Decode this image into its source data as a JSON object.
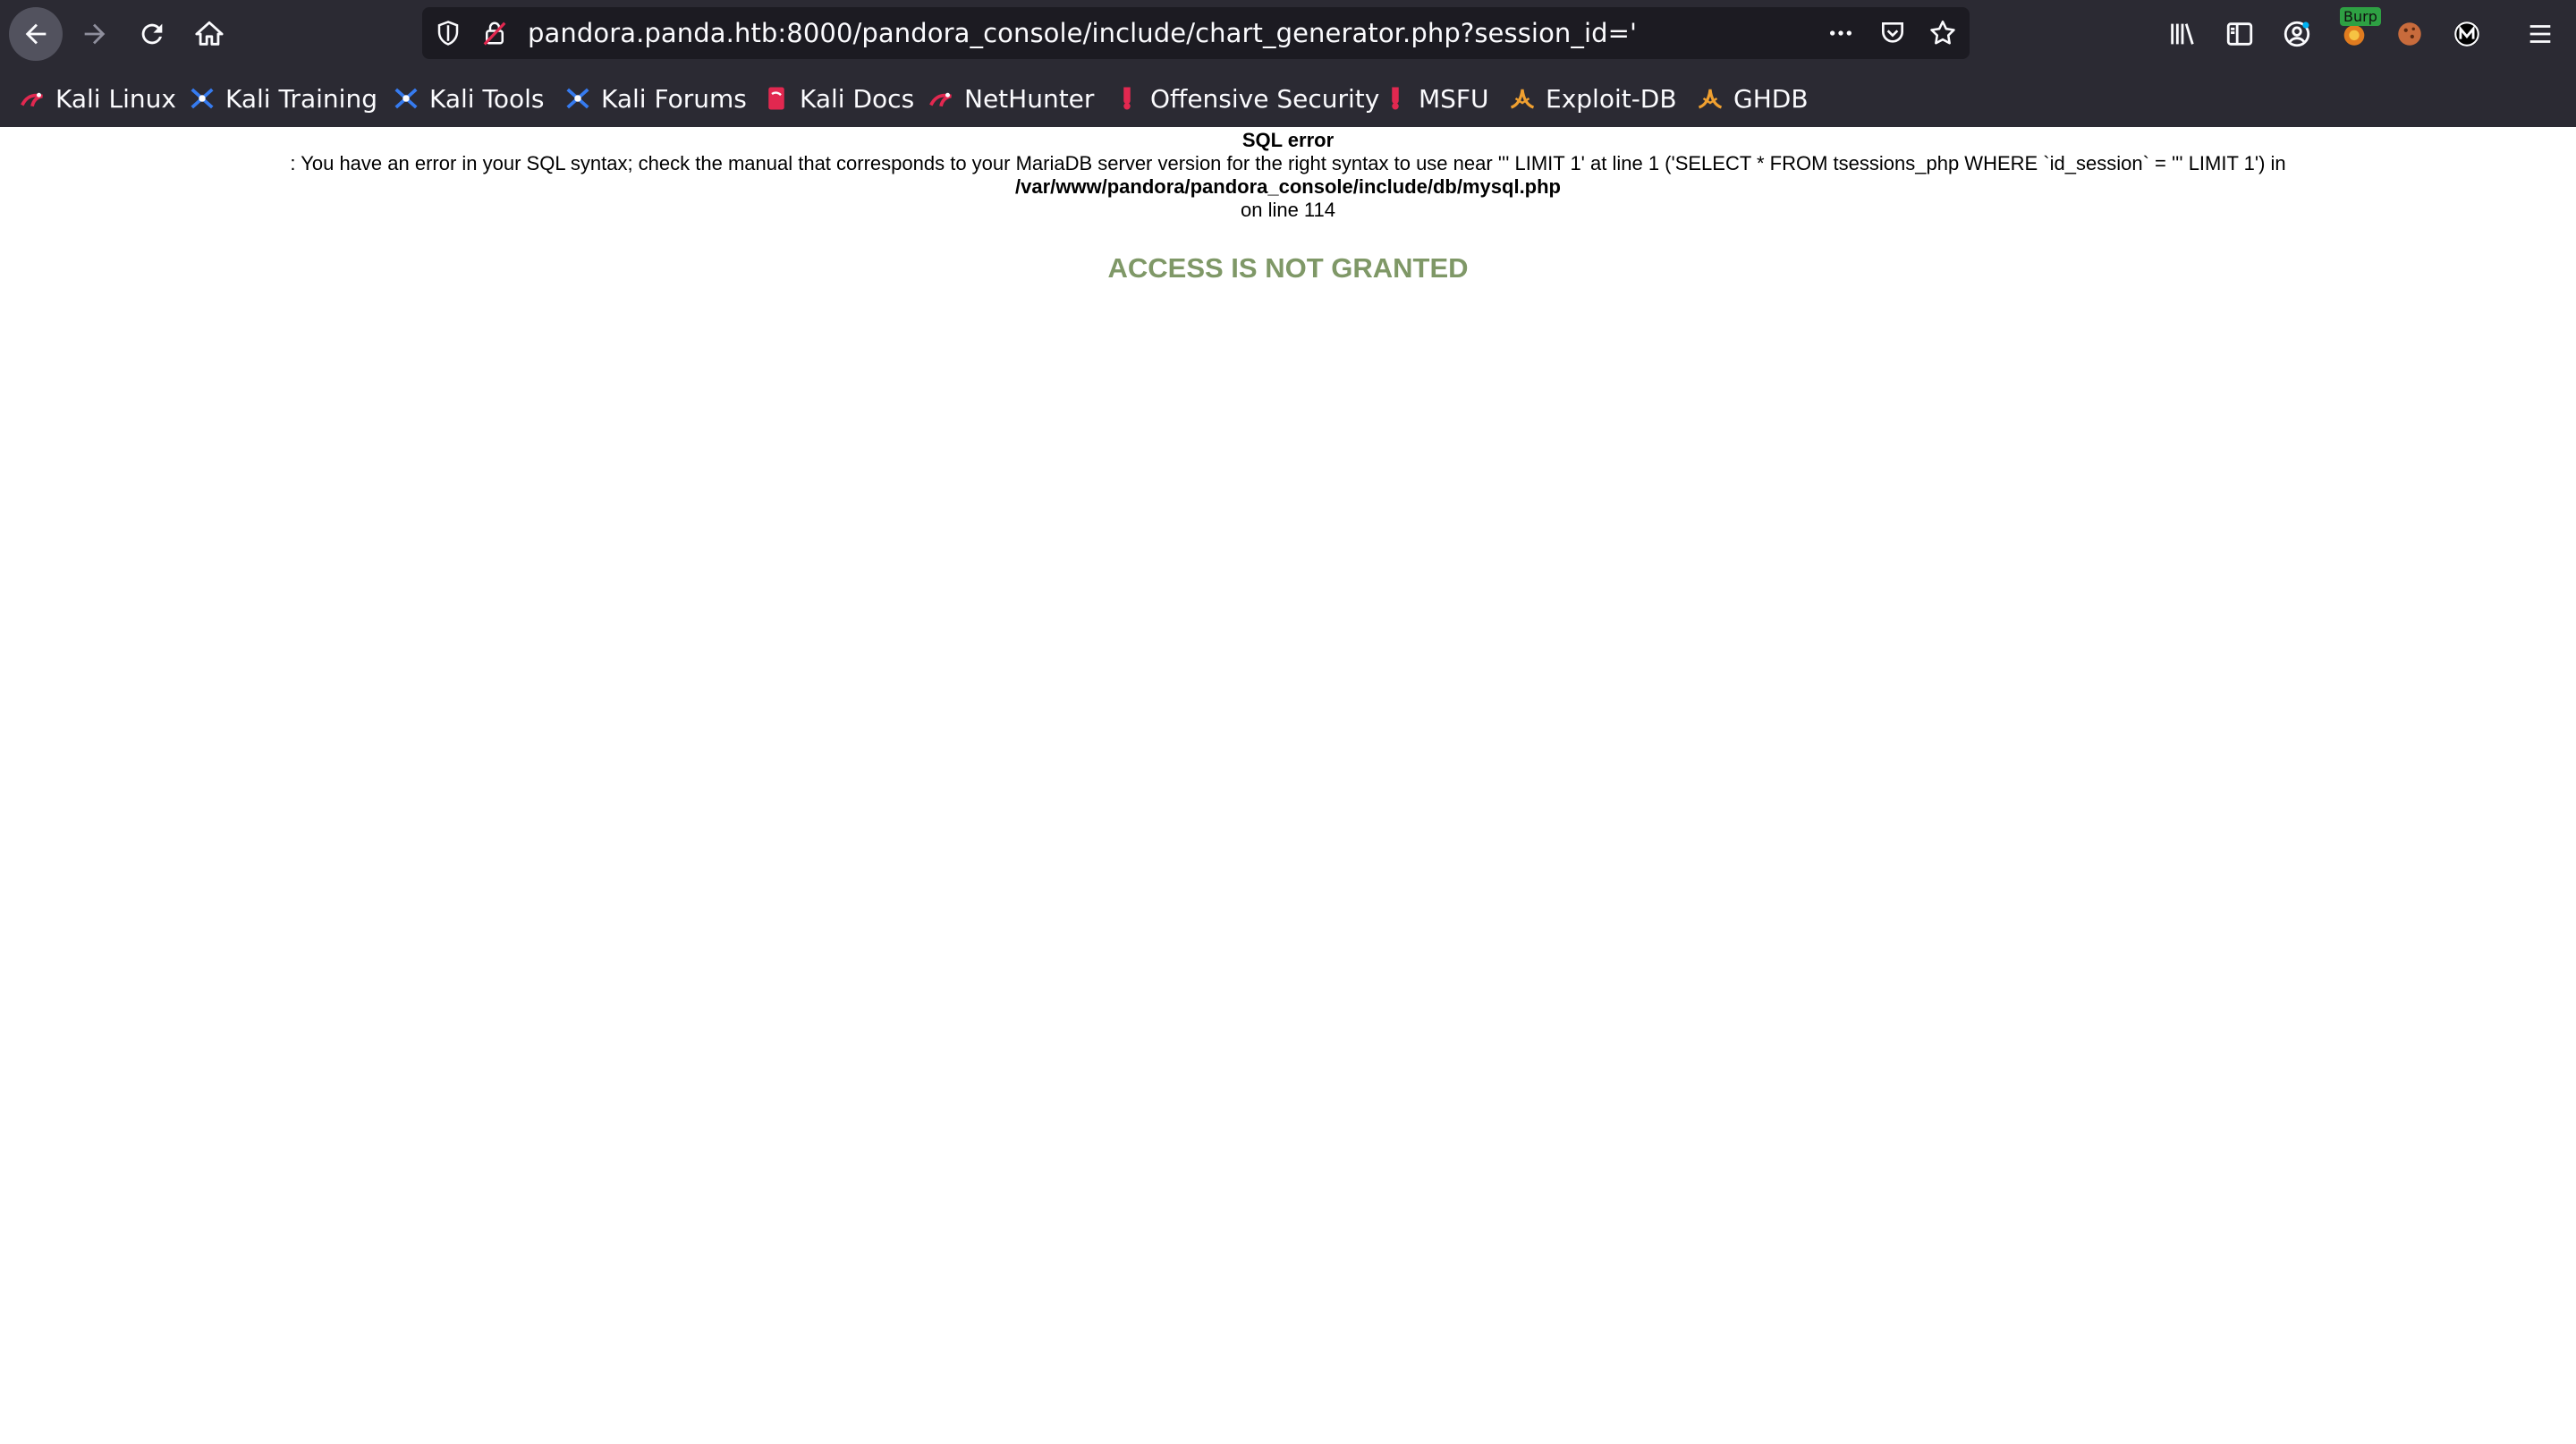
{
  "browser": {
    "url": "pandora.panda.htb:8000/pandora_console/include/chart_generator.php?session_id='",
    "burp_badge": "Burp",
    "bookmarks": [
      {
        "label": "Kali Linux",
        "icon": "kali-dragon-icon"
      },
      {
        "label": "Kali Training",
        "icon": "kali-training-icon"
      },
      {
        "label": "Kali Tools",
        "icon": "kali-tools-icon"
      },
      {
        "label": "Kali Forums",
        "icon": "kali-forums-icon"
      },
      {
        "label": "Kali Docs",
        "icon": "kali-docs-icon"
      },
      {
        "label": "NetHunter",
        "icon": "nethunter-icon"
      },
      {
        "label": "Offensive Security",
        "icon": "offsec-icon"
      },
      {
        "label": "MSFU",
        "icon": "msfu-icon"
      },
      {
        "label": "Exploit-DB",
        "icon": "exploitdb-icon"
      },
      {
        "label": "GHDB",
        "icon": "ghdb-icon"
      }
    ]
  },
  "page": {
    "error_title": "SQL error",
    "error_message": ": You have an error in your SQL syntax; check the manual that corresponds to your MariaDB server version for the right syntax to use near ''' LIMIT 1' at line 1 ('SELECT * FROM tsessions_php WHERE `id_session` = ''' LIMIT 1') in",
    "error_file": "/var/www/pandora/pandora_console/include/db/mysql.php",
    "error_line": "on line 114",
    "access_message": "ACCESS IS NOT GRANTED"
  },
  "colors": {
    "chrome_bg": "#2b2a33",
    "urlbar_bg": "#1c1b22",
    "access_text": "#7f9867",
    "burp_badge": "#2ea043"
  }
}
